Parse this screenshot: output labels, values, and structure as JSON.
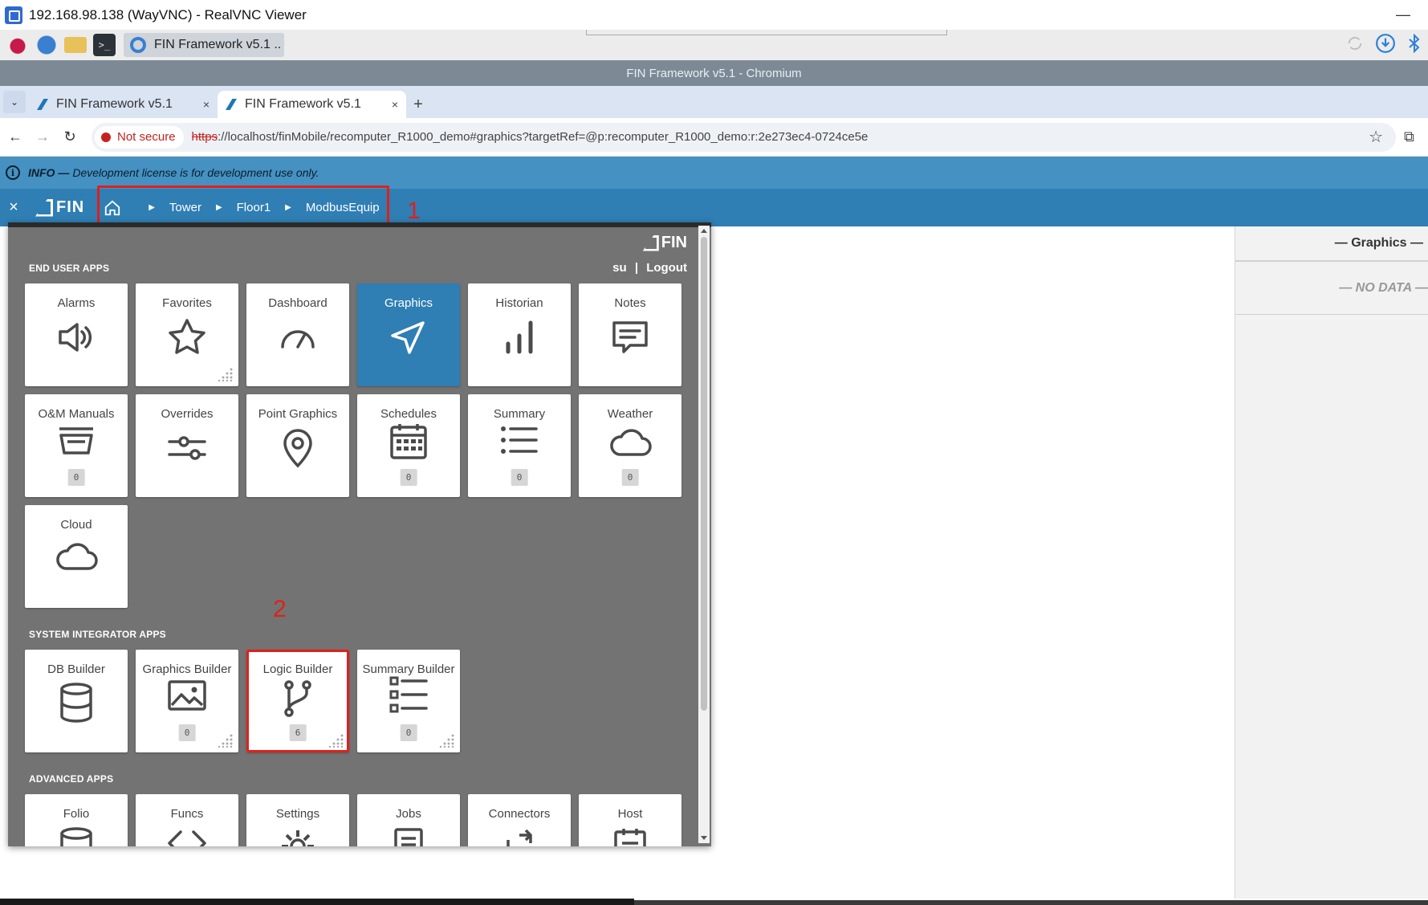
{
  "vnc": {
    "title": "192.168.98.138 (WayVNC) - RealVNC Viewer",
    "minimize": "—"
  },
  "taskbar": {
    "task_label": "FIN Framework v5.1 ..",
    "terminal_glyph": ">_"
  },
  "browser": {
    "window_title": "FIN Framework v5.1 - Chromium",
    "tabs": [
      {
        "label": "FIN Framework v5.1",
        "close": "×"
      },
      {
        "label": "FIN Framework v5.1",
        "close": "×"
      }
    ],
    "new_tab": "+",
    "not_secure": "Not secure",
    "url_scheme": "https",
    "url_rest": "://localhost/finMobile/recomputer_R1000_demo#graphics?targetRef=@p:recomputer_R1000_demo:r:2e273ec4-0724ce5e"
  },
  "info": {
    "label": "INFO —",
    "message": "Development license is for development use only."
  },
  "header": {
    "close": "×",
    "logo": "FIN",
    "breadcrumbs": [
      "Tower",
      "Floor1",
      "ModbusEquip"
    ]
  },
  "annotations": {
    "one": "1",
    "two": "2"
  },
  "launcher": {
    "logo": "FIN",
    "user": "su",
    "divider": "|",
    "logout": "Logout",
    "sections": {
      "end_user": "END USER APPS",
      "system_integrator": "SYSTEM INTEGRATOR APPS",
      "advanced": "ADVANCED APPS"
    },
    "end_user_apps": [
      {
        "label": "Alarms",
        "icon": "speaker-icon"
      },
      {
        "label": "Favorites",
        "icon": "star-icon"
      },
      {
        "label": "Dashboard",
        "icon": "gauge-icon"
      },
      {
        "label": "Graphics",
        "icon": "navigation-arrow-icon"
      },
      {
        "label": "Historian",
        "icon": "bar-chart-icon"
      },
      {
        "label": "Notes",
        "icon": "message-icon"
      },
      {
        "label": "O&M Manuals",
        "icon": "basket-icon",
        "badge": "0"
      },
      {
        "label": "Overrides",
        "icon": "sliders-icon"
      },
      {
        "label": "Point Graphics",
        "icon": "map-pin-icon"
      },
      {
        "label": "Schedules",
        "icon": "calendar-icon",
        "badge": "0"
      },
      {
        "label": "Summary",
        "icon": "list-icon",
        "badge": "0"
      },
      {
        "label": "Weather",
        "icon": "cloud-icon",
        "badge": "0"
      },
      {
        "label": "Cloud",
        "icon": "cloud-icon"
      }
    ],
    "system_integrator_apps": [
      {
        "label": "DB Builder",
        "icon": "database-icon"
      },
      {
        "label": "Graphics Builder",
        "icon": "image-icon",
        "badge": "0"
      },
      {
        "label": "Logic Builder",
        "icon": "git-branch-icon",
        "badge": "6"
      },
      {
        "label": "Summary Builder",
        "icon": "checklist-icon",
        "badge": "0"
      }
    ],
    "advanced_apps": [
      {
        "label": "Folio",
        "icon": "database-icon"
      },
      {
        "label": "Funcs",
        "icon": "code-icon"
      },
      {
        "label": "Settings",
        "icon": "gear-icon"
      },
      {
        "label": "Jobs",
        "icon": "document-icon"
      },
      {
        "label": "Connectors",
        "icon": "connector-icon"
      },
      {
        "label": "Host",
        "icon": "clipboard-icon"
      }
    ]
  },
  "side_panel": {
    "title": "— Graphics —",
    "empty": "— NO DATA —"
  },
  "colors": {
    "fin_blue": "#2f7eb4",
    "info_blue": "#4591c2",
    "launcher_gray": "#737373",
    "annotation_red": "#e0201b"
  }
}
